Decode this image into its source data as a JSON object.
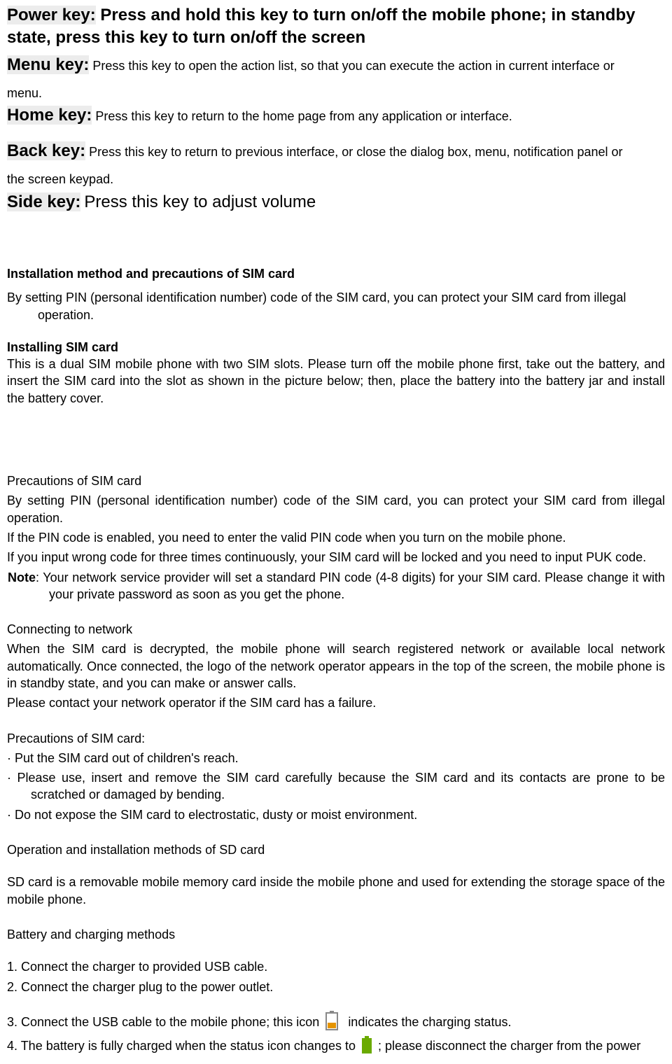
{
  "keys": {
    "power": {
      "label": "Power key:",
      "desc": "Press and hold this key to turn on/off the mobile phone; in standby state, press this key to turn on/off the screen"
    },
    "menu": {
      "label": "Menu key:",
      "desc_a": "Press this key to open the action list, so that you can execute the action in current interface or",
      "desc_b": "menu."
    },
    "home": {
      "label": "Home key:",
      "desc": "Press this key to return to the home page from any application or interface."
    },
    "back": {
      "label": "Back key:",
      "desc_a": "Press this key to return to previous interface, or close the dialog box, menu, notification panel or",
      "desc_b": "the screen keypad."
    },
    "side": {
      "label": "Side key:",
      "desc": "Press this key to adjust volume"
    }
  },
  "sim": {
    "heading": "Installation method and precautions of SIM card",
    "intro": "By setting PIN (personal identification number) code of the SIM card, you can protect your SIM card from illegal operation.",
    "install_heading": "Installing SIM card",
    "install_text": "This is a dual SIM mobile phone with two SIM slots. Please turn off the mobile phone first, take out the battery, and insert the SIM card into the slot as shown in the picture below; then, place the battery into the battery jar and install the battery cover.",
    "precautions_heading": "Precautions of SIM card",
    "prec_p1": "By setting PIN (personal identification number) code of the SIM card, you can protect your SIM card from illegal operation.",
    "prec_p2": "If the PIN code is enabled, you need to enter the valid PIN code when you turn on the mobile phone.",
    "prec_p3": "If you input wrong code for three times continuously, your SIM card will be locked and you need to input PUK code.",
    "note_label": "Note",
    "note_text": ": Your network service provider will set a standard PIN code (4-8 digits) for your SIM card. Please change it with your private password as soon as you get the phone."
  },
  "network": {
    "heading": "Connecting to network",
    "p1": "When the SIM card is decrypted, the mobile phone will search registered network or available local network automatically. Once connected, the logo of the network operator appears in the top of the screen, the mobile phone is in standby state, and you can make or answer calls.",
    "p2": "Please contact your network operator if the SIM card has a failure."
  },
  "sim_precautions": {
    "heading": "Precautions of SIM card:",
    "b1": "· Put the SIM card out of children's reach.",
    "b2": "· Please use, insert and remove the SIM card carefully because the SIM card and its contacts are prone to be scratched or damaged by bending.",
    "b3": "· Do not expose the SIM card to electrostatic, dusty or moist environment."
  },
  "sd": {
    "heading": "Operation and installation methods of SD card",
    "text": "SD card is a removable mobile memory card inside the mobile phone and used for extending the storage space of the mobile phone."
  },
  "battery": {
    "heading": "Battery and charging methods",
    "s1": "1. Connect the charger to provided USB cable.",
    "s2": "2. Connect the charger plug to the power outlet.",
    "s3a": "3. Connect the USB cable to the mobile phone; this icon",
    "s3b": "indicates the charging status.",
    "s4a": "4. The battery is fully charged when the status icon changes to",
    "s4b": "; please disconnect the charger from the power"
  }
}
